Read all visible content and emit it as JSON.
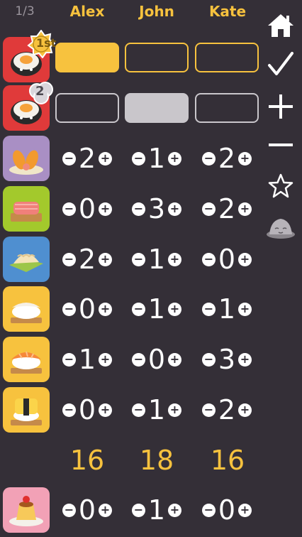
{
  "header": {
    "round": "1/3",
    "players": [
      "Alex",
      "John",
      "Kate"
    ]
  },
  "maki_rows": [
    {
      "name": "maki-1st",
      "badge": "1st",
      "badge_color": "#f7c23e",
      "states": [
        "filled-yellow",
        "outline-yellow",
        "outline-yellow"
      ]
    },
    {
      "name": "maki-2nd",
      "badge": "2",
      "badge_color": "#d9d6db",
      "states": [
        "outline-grey",
        "filled-grey",
        "outline-grey"
      ]
    }
  ],
  "scoring_rows": [
    {
      "name": "tempura",
      "icon": "tempura-icon",
      "bg": "#a98fc4",
      "values": [
        "2",
        "1",
        "2"
      ]
    },
    {
      "name": "sashimi",
      "icon": "sashimi-icon",
      "bg": "#a3c92c",
      "values": [
        "0",
        "3",
        "2"
      ]
    },
    {
      "name": "dumpling",
      "icon": "dumpling-icon",
      "bg": "#4f8fd0",
      "values": [
        "2",
        "1",
        "0"
      ]
    },
    {
      "name": "squid-nigiri",
      "icon": "squid-nigiri-icon",
      "bg": "#f7c23e",
      "values": [
        "0",
        "1",
        "1"
      ]
    },
    {
      "name": "salmon-nigiri",
      "icon": "salmon-nigiri-icon",
      "bg": "#f7c23e",
      "values": [
        "1",
        "0",
        "3"
      ]
    },
    {
      "name": "egg-nigiri",
      "icon": "egg-nigiri-icon",
      "bg": "#f7c23e",
      "values": [
        "0",
        "1",
        "2"
      ]
    }
  ],
  "totals": [
    "16",
    "18",
    "16"
  ],
  "pudding_row": {
    "name": "pudding",
    "icon": "pudding-icon",
    "bg": "#f2a1b6",
    "values": [
      "0",
      "1",
      "0"
    ]
  },
  "buttons": {
    "minus": "−",
    "plus": "+"
  },
  "sidebar": [
    "home-icon",
    "checkmark-icon",
    "plus-icon",
    "minus-icon",
    "star-icon",
    "rock-icon"
  ],
  "colors": {
    "background": "#342f37",
    "accent": "#f7c23e",
    "grey": "#c9c6cb"
  }
}
